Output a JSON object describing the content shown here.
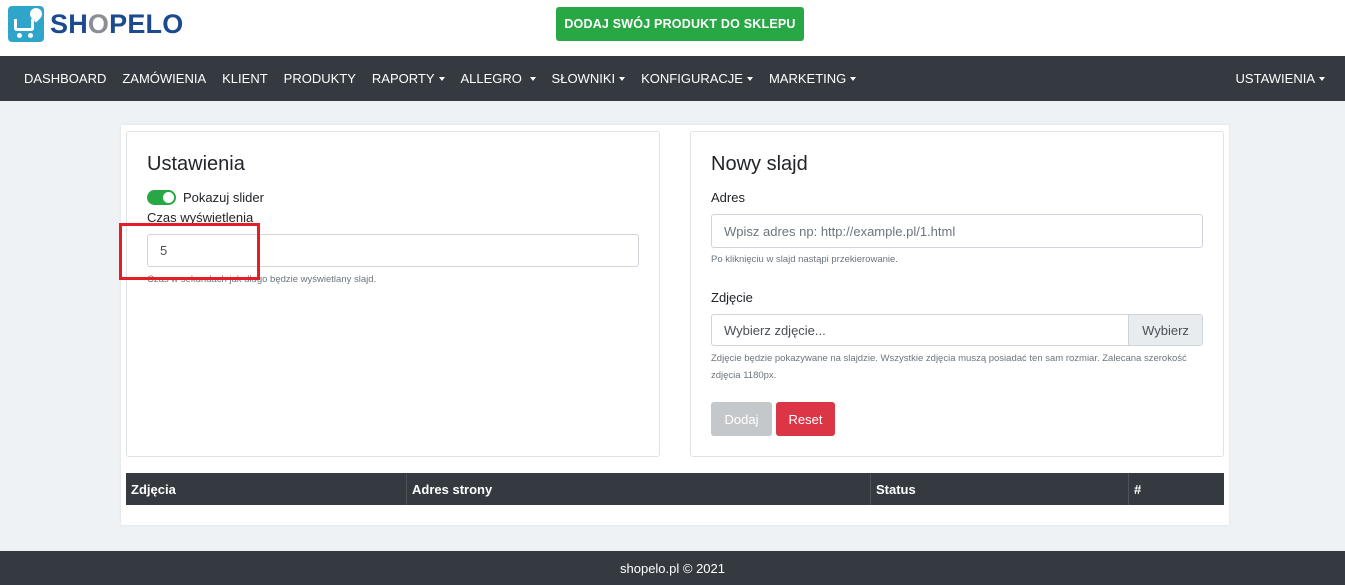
{
  "brand": {
    "name_pre": "SH",
    "name_o": "O",
    "name_post": "PELO"
  },
  "cta": {
    "label": "DODAJ SWÓJ PRODUKT DO SKLEPU"
  },
  "nav": {
    "items": [
      {
        "label": "DASHBOARD",
        "dropdown": false
      },
      {
        "label": "ZAMÓWIENIA",
        "dropdown": false
      },
      {
        "label": "KLIENT",
        "dropdown": false
      },
      {
        "label": "PRODUKTY",
        "dropdown": false
      },
      {
        "label": "RAPORTY",
        "dropdown": true
      },
      {
        "label": "ALLEGRO",
        "dropdown": true
      },
      {
        "label": "SŁOWNIKI",
        "dropdown": true
      },
      {
        "label": "KONFIGURACJE",
        "dropdown": true
      },
      {
        "label": "MARKETING",
        "dropdown": true
      }
    ],
    "right": {
      "label": "USTAWIENIA"
    }
  },
  "settings": {
    "title": "Ustawienia",
    "toggle_label": "Pokazuj slider",
    "time_label": "Czas wyświetlenia",
    "time_value": "5",
    "time_help": "Czas w sekundach jak długo będzie wyświetlany slajd."
  },
  "new_slide": {
    "title": "Nowy slajd",
    "address_label": "Adres",
    "address_placeholder": "Wpisz adres np: http://example.pl/1.html",
    "address_help": "Po kliknięciu w slajd nastąpi przekierowanie.",
    "image_label": "Zdjęcie",
    "image_placeholder": "Wybierz zdjęcie...",
    "browse_label": "Wybierz",
    "image_help": "Zdjęcie będzie pokazywane na slajdzie. Wszystkie zdjęcia muszą posiadać ten sam rozmiar. Zalecana szerokość zdjęcia 1180px.",
    "add_label": "Dodaj",
    "reset_label": "Reset"
  },
  "table": {
    "columns": [
      "Zdjęcia",
      "Adres strony",
      "Status",
      "#"
    ]
  },
  "footer": {
    "text": "shopelo.pl © 2021"
  },
  "colors": {
    "nav_bg": "#343a40",
    "success": "#28a745",
    "danger": "#dc3545",
    "brand_blue": "#1c4a8f",
    "highlight": "#e41e26"
  }
}
